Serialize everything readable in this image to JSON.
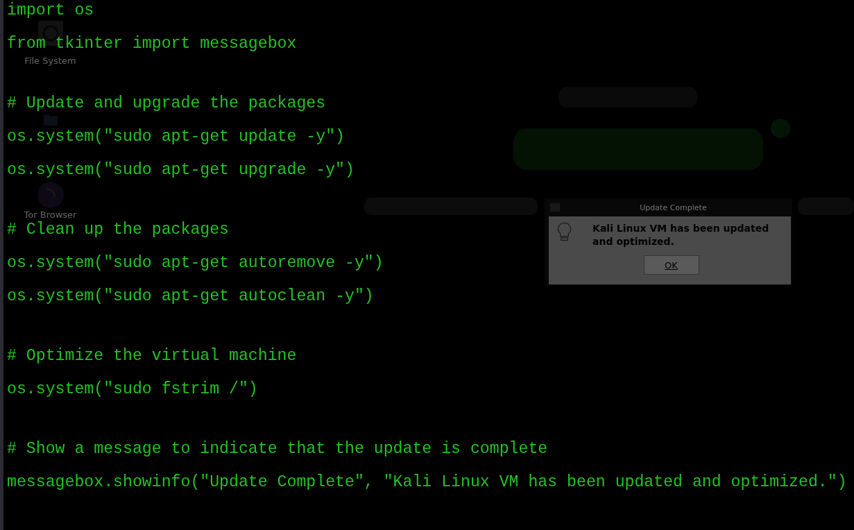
{
  "desktop": {
    "icons": [
      {
        "kind": "drive",
        "label": "File System"
      },
      {
        "kind": "folder"
      },
      {
        "kind": "globe",
        "label": "Tor Browser"
      }
    ]
  },
  "dialog": {
    "title": "Update Complete",
    "message": "Kali Linux VM has been updated and optimized.",
    "buttons": [
      "OK"
    ]
  },
  "editor": {
    "blocks": [
      [
        "import os",
        "from tkinter import messagebox"
      ],
      [
        "# Update and upgrade the packages",
        "os.system(\"sudo apt-get update -y\")",
        "os.system(\"sudo apt-get upgrade -y\")"
      ],
      [
        "# Clean up the packages",
        "os.system(\"sudo apt-get autoremove -y\")",
        "os.system(\"sudo apt-get autoclean -y\")"
      ],
      [
        "# Optimize the virtual machine",
        "os.system(\"sudo fstrim /\")"
      ],
      [
        "# Show a message to indicate that the update is complete",
        "messagebox.showinfo(\"Update Complete\", \"Kali Linux VM has been updated and optimized.\")"
      ]
    ]
  }
}
